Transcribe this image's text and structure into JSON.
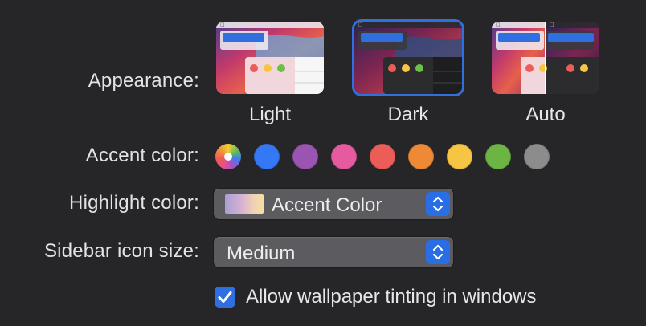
{
  "appearance": {
    "label": "Appearance:",
    "options": [
      {
        "label": "Light"
      },
      {
        "label": "Dark"
      },
      {
        "label": "Auto"
      }
    ],
    "selected": "Dark"
  },
  "accent": {
    "label": "Accent color:",
    "colors": [
      {
        "name": "multicolor",
        "hex": "multicolor"
      },
      {
        "name": "blue",
        "hex": "#3478f6"
      },
      {
        "name": "purple",
        "hex": "#9a55b3"
      },
      {
        "name": "pink",
        "hex": "#e65ba0"
      },
      {
        "name": "red",
        "hex": "#ec5d57"
      },
      {
        "name": "orange",
        "hex": "#ee8a36"
      },
      {
        "name": "yellow",
        "hex": "#f6c544"
      },
      {
        "name": "green",
        "hex": "#6cb545"
      },
      {
        "name": "graphite",
        "hex": "#8c8c8c"
      }
    ],
    "selected": "multicolor"
  },
  "highlight": {
    "label": "Highlight color:",
    "value": "Accent Color"
  },
  "sidebar_icon_size": {
    "label": "Sidebar icon size:",
    "value": "Medium"
  },
  "wallpaper_tinting": {
    "label": "Allow wallpaper tinting in windows",
    "checked": true
  }
}
